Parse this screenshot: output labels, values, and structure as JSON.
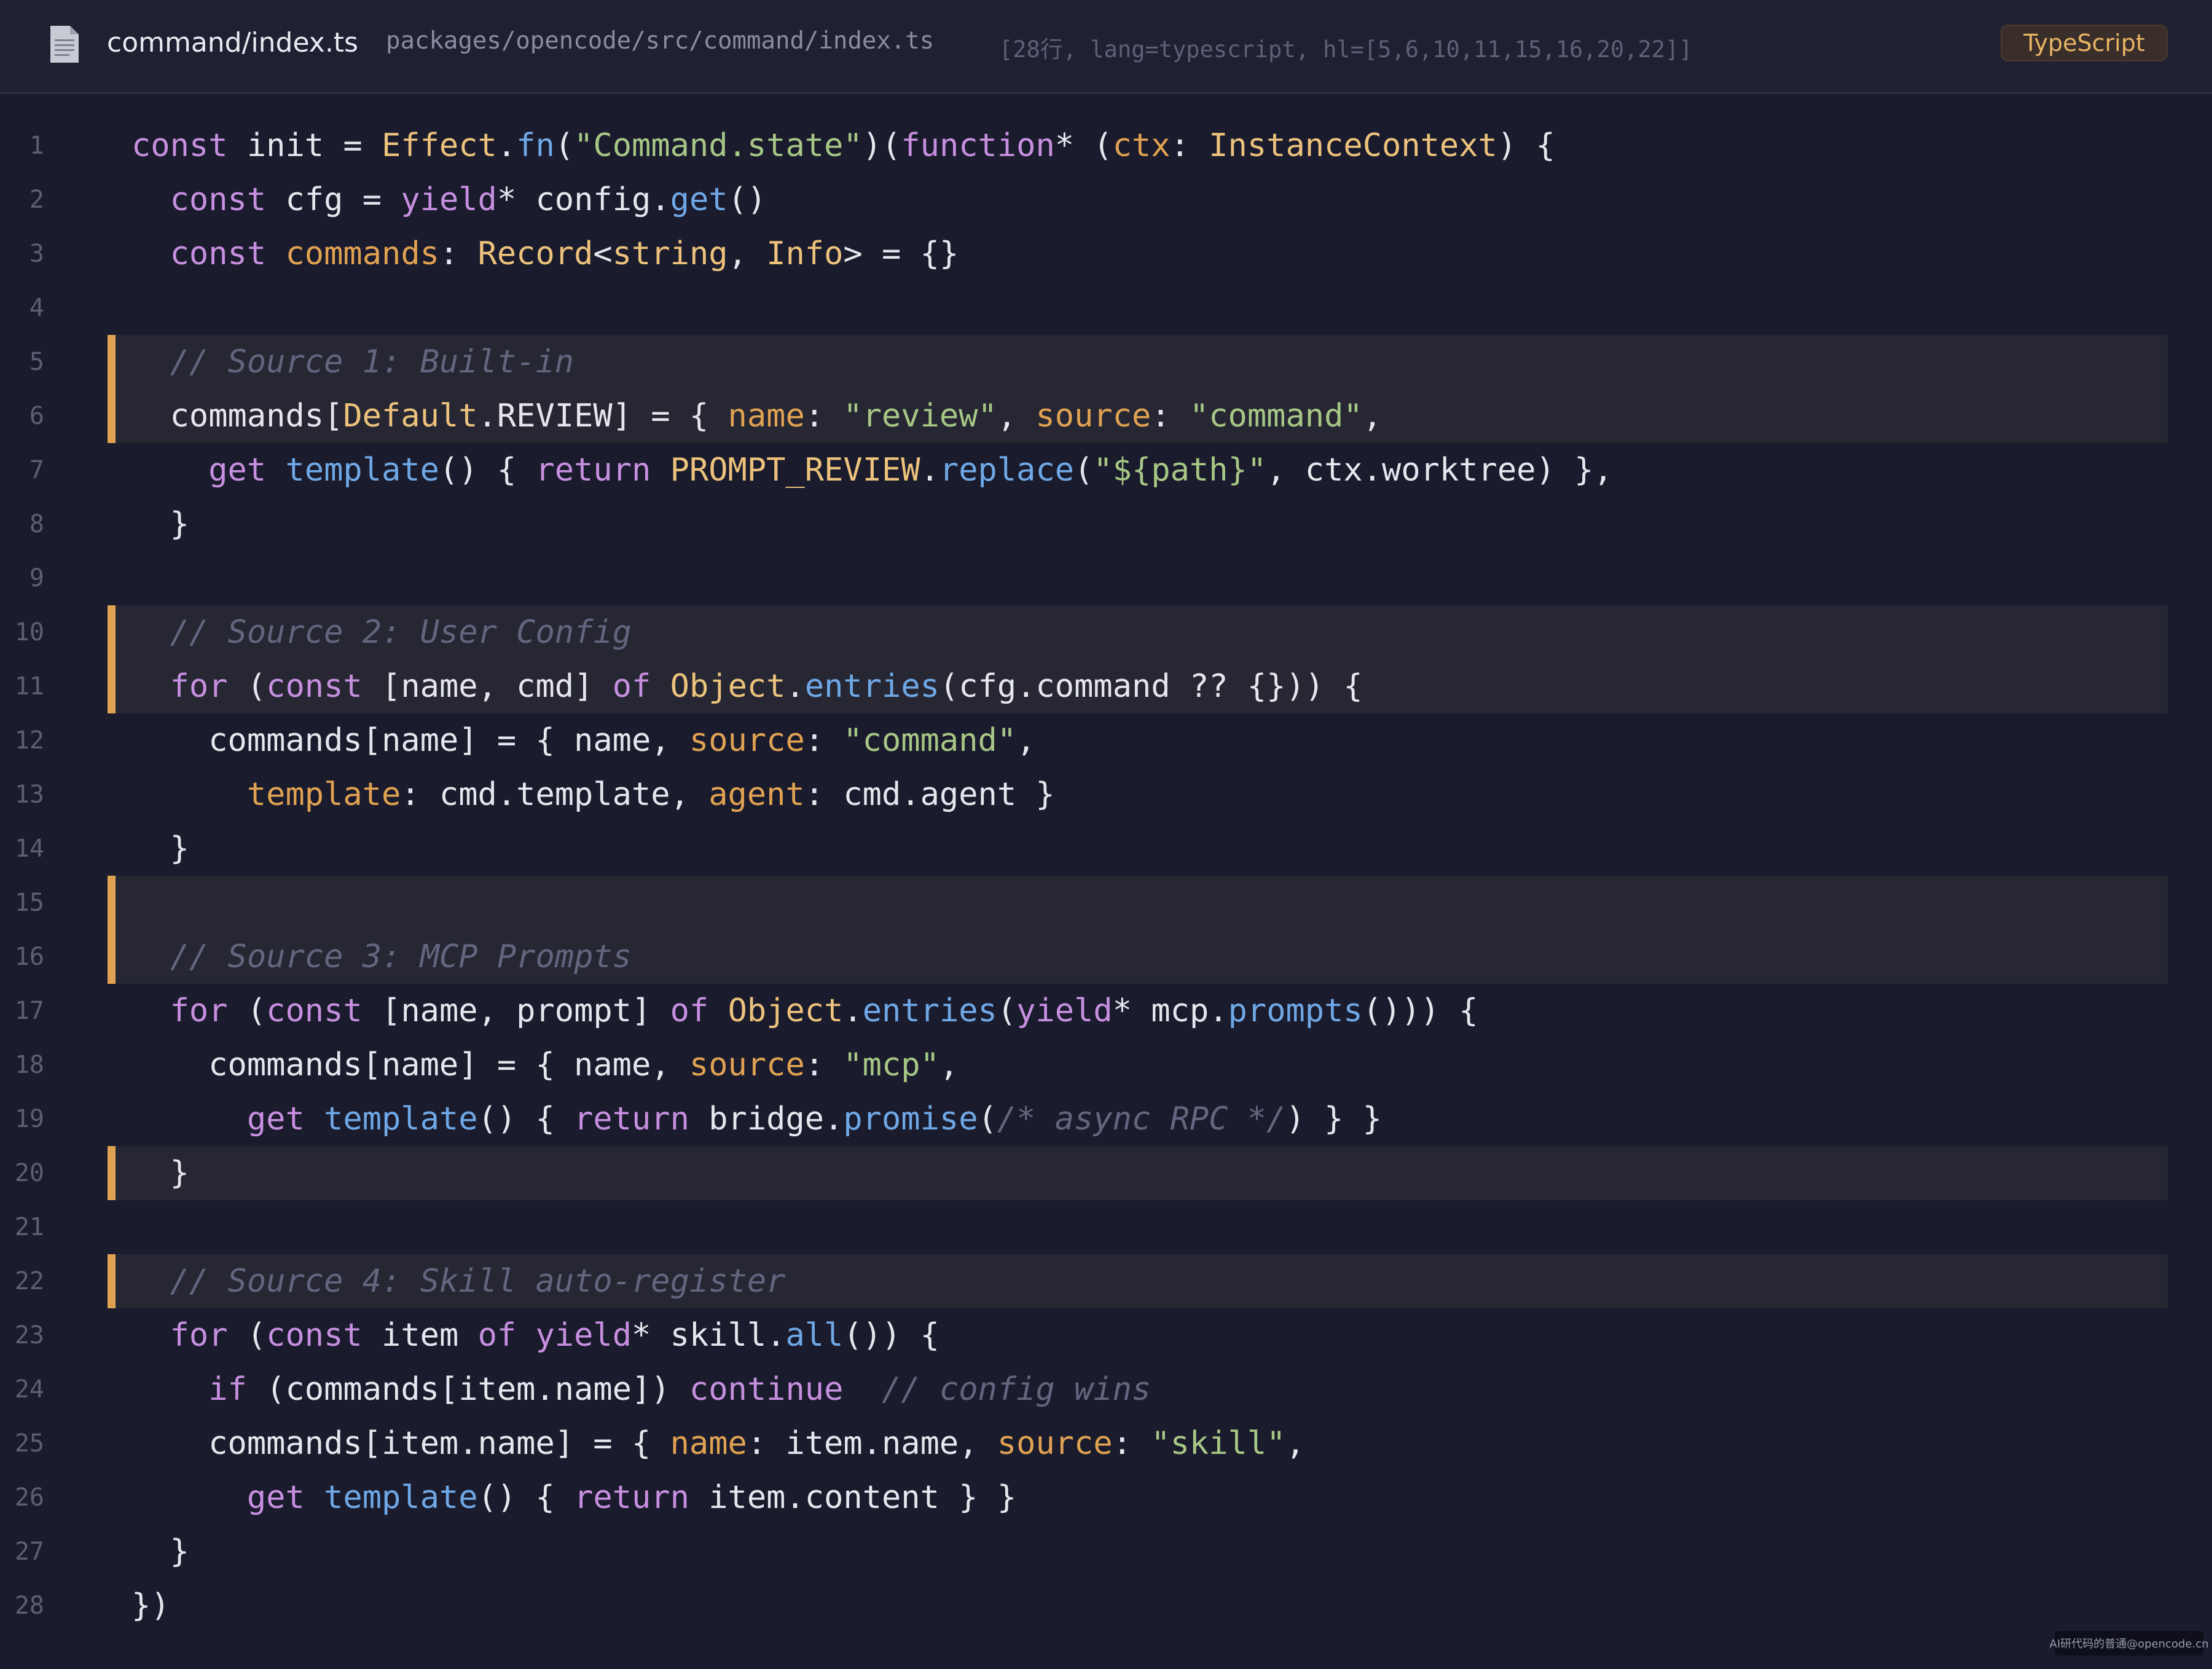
{
  "header": {
    "file_name": "command/index.ts",
    "file_path": "packages/opencode/src/command/index.ts",
    "file_meta": "[28行, lang=typescript, hl=[5,6,10,11,15,16,20,22]]",
    "language": "TypeScript",
    "icon": "document-icon"
  },
  "colors": {
    "background": "#1a1b2c",
    "highlight_bar": "#e0a252",
    "keyword": "#c78fe0",
    "function": "#6fa8e6",
    "type": "#ecc27c",
    "property": "#e0a252",
    "string": "#a6c785",
    "comment": "#62667e"
  },
  "code": {
    "highlighted_lines": [
      5,
      6,
      10,
      11,
      15,
      16,
      20,
      22
    ],
    "lines": [
      {
        "n": "1",
        "tokens": [
          [
            "kw",
            "const"
          ],
          [
            "pl",
            " init = "
          ],
          [
            "ty",
            "Effect"
          ],
          [
            "pl",
            "."
          ],
          [
            "fn",
            "fn"
          ],
          [
            "pl",
            "("
          ],
          [
            "st",
            "\"Command.state\""
          ],
          [
            "pl",
            ")("
          ],
          [
            "kw",
            "function"
          ],
          [
            "pl",
            "* ("
          ],
          [
            "pr",
            "ctx"
          ],
          [
            "pl",
            ": "
          ],
          [
            "ty",
            "InstanceContext"
          ],
          [
            "pl",
            ") {"
          ]
        ]
      },
      {
        "n": "2",
        "tokens": [
          [
            "pl",
            "  "
          ],
          [
            "kw",
            "const"
          ],
          [
            "pl",
            " cfg = "
          ],
          [
            "kw",
            "yield"
          ],
          [
            "pl",
            "* config."
          ],
          [
            "fn",
            "get"
          ],
          [
            "pl",
            "()"
          ]
        ]
      },
      {
        "n": "3",
        "tokens": [
          [
            "pl",
            "  "
          ],
          [
            "kw",
            "const"
          ],
          [
            "pl",
            " "
          ],
          [
            "pr",
            "commands"
          ],
          [
            "pl",
            ": "
          ],
          [
            "ty",
            "Record"
          ],
          [
            "pl",
            "<"
          ],
          [
            "ty",
            "string"
          ],
          [
            "pl",
            ", "
          ],
          [
            "ty",
            "Info"
          ],
          [
            "pl",
            "> = {}"
          ]
        ]
      },
      {
        "n": "4",
        "tokens": []
      },
      {
        "n": "5",
        "tokens": [
          [
            "pl",
            "  "
          ],
          [
            "cm",
            "// Source 1: Built-in"
          ]
        ]
      },
      {
        "n": "6",
        "tokens": [
          [
            "pl",
            "  commands["
          ],
          [
            "ty",
            "Default"
          ],
          [
            "pl",
            ".REVIEW] = { "
          ],
          [
            "pr",
            "name"
          ],
          [
            "pl",
            ": "
          ],
          [
            "st",
            "\"review\""
          ],
          [
            "pl",
            ", "
          ],
          [
            "pr",
            "source"
          ],
          [
            "pl",
            ": "
          ],
          [
            "st",
            "\"command\""
          ],
          [
            "pl",
            ","
          ]
        ]
      },
      {
        "n": "7",
        "tokens": [
          [
            "pl",
            "    "
          ],
          [
            "kw",
            "get"
          ],
          [
            "pl",
            " "
          ],
          [
            "fn",
            "template"
          ],
          [
            "pl",
            "() { "
          ],
          [
            "kw",
            "return"
          ],
          [
            "pl",
            " "
          ],
          [
            "ty",
            "PROMPT_REVIEW"
          ],
          [
            "pl",
            "."
          ],
          [
            "fn",
            "replace"
          ],
          [
            "pl",
            "("
          ],
          [
            "st",
            "\"${path}\""
          ],
          [
            "pl",
            ", ctx.worktree) },"
          ]
        ]
      },
      {
        "n": "8",
        "tokens": [
          [
            "pl",
            "  }"
          ]
        ]
      },
      {
        "n": "9",
        "tokens": []
      },
      {
        "n": "10",
        "tokens": [
          [
            "pl",
            "  "
          ],
          [
            "cm",
            "// Source 2: User Config"
          ]
        ]
      },
      {
        "n": "11",
        "tokens": [
          [
            "pl",
            "  "
          ],
          [
            "kw",
            "for"
          ],
          [
            "pl",
            " ("
          ],
          [
            "kw",
            "const"
          ],
          [
            "pl",
            " [name, cmd] "
          ],
          [
            "kw",
            "of"
          ],
          [
            "pl",
            " "
          ],
          [
            "ty",
            "Object"
          ],
          [
            "pl",
            "."
          ],
          [
            "fn",
            "entries"
          ],
          [
            "pl",
            "(cfg.command ?? {})) {"
          ]
        ]
      },
      {
        "n": "12",
        "tokens": [
          [
            "pl",
            "    commands[name] = { name, "
          ],
          [
            "pr",
            "source"
          ],
          [
            "pl",
            ": "
          ],
          [
            "st",
            "\"command\""
          ],
          [
            "pl",
            ","
          ]
        ]
      },
      {
        "n": "13",
        "tokens": [
          [
            "pl",
            "      "
          ],
          [
            "pr",
            "template"
          ],
          [
            "pl",
            ": cmd.template, "
          ],
          [
            "pr",
            "agent"
          ],
          [
            "pl",
            ": cmd.agent }"
          ]
        ]
      },
      {
        "n": "14",
        "tokens": [
          [
            "pl",
            "  }"
          ]
        ]
      },
      {
        "n": "15",
        "tokens": []
      },
      {
        "n": "16",
        "tokens": [
          [
            "pl",
            "  "
          ],
          [
            "cm",
            "// Source 3: MCP Prompts"
          ]
        ]
      },
      {
        "n": "17",
        "tokens": [
          [
            "pl",
            "  "
          ],
          [
            "kw",
            "for"
          ],
          [
            "pl",
            " ("
          ],
          [
            "kw",
            "const"
          ],
          [
            "pl",
            " [name, prompt] "
          ],
          [
            "kw",
            "of"
          ],
          [
            "pl",
            " "
          ],
          [
            "ty",
            "Object"
          ],
          [
            "pl",
            "."
          ],
          [
            "fn",
            "entries"
          ],
          [
            "pl",
            "("
          ],
          [
            "kw",
            "yield"
          ],
          [
            "pl",
            "* mcp."
          ],
          [
            "fn",
            "prompts"
          ],
          [
            "pl",
            "())) {"
          ]
        ]
      },
      {
        "n": "18",
        "tokens": [
          [
            "pl",
            "    commands[name] = { name, "
          ],
          [
            "pr",
            "source"
          ],
          [
            "pl",
            ": "
          ],
          [
            "st",
            "\"mcp\""
          ],
          [
            "pl",
            ","
          ]
        ]
      },
      {
        "n": "19",
        "tokens": [
          [
            "pl",
            "      "
          ],
          [
            "kw",
            "get"
          ],
          [
            "pl",
            " "
          ],
          [
            "fn",
            "template"
          ],
          [
            "pl",
            "() { "
          ],
          [
            "kw",
            "return"
          ],
          [
            "pl",
            " bridge."
          ],
          [
            "fn",
            "promise"
          ],
          [
            "pl",
            "("
          ],
          [
            "cm",
            "/* async RPC */"
          ],
          [
            "pl",
            ") } }"
          ]
        ]
      },
      {
        "n": "20",
        "tokens": [
          [
            "pl",
            "  }"
          ]
        ]
      },
      {
        "n": "21",
        "tokens": []
      },
      {
        "n": "22",
        "tokens": [
          [
            "pl",
            "  "
          ],
          [
            "cm",
            "// Source 4: Skill auto-register"
          ]
        ]
      },
      {
        "n": "23",
        "tokens": [
          [
            "pl",
            "  "
          ],
          [
            "kw",
            "for"
          ],
          [
            "pl",
            " ("
          ],
          [
            "kw",
            "const"
          ],
          [
            "pl",
            " item "
          ],
          [
            "kw",
            "of"
          ],
          [
            "pl",
            " "
          ],
          [
            "kw",
            "yield"
          ],
          [
            "pl",
            "* skill."
          ],
          [
            "fn",
            "all"
          ],
          [
            "pl",
            "()) {"
          ]
        ]
      },
      {
        "n": "24",
        "tokens": [
          [
            "pl",
            "    "
          ],
          [
            "kw",
            "if"
          ],
          [
            "pl",
            " (commands[item.name]) "
          ],
          [
            "kw",
            "continue"
          ],
          [
            "pl",
            "  "
          ],
          [
            "cm",
            "// config wins"
          ]
        ]
      },
      {
        "n": "25",
        "tokens": [
          [
            "pl",
            "    commands[item.name] = { "
          ],
          [
            "pr",
            "name"
          ],
          [
            "pl",
            ": item.name, "
          ],
          [
            "pr",
            "source"
          ],
          [
            "pl",
            ": "
          ],
          [
            "st",
            "\"skill\""
          ],
          [
            "pl",
            ","
          ]
        ]
      },
      {
        "n": "26",
        "tokens": [
          [
            "pl",
            "      "
          ],
          [
            "kw",
            "get"
          ],
          [
            "pl",
            " "
          ],
          [
            "fn",
            "template"
          ],
          [
            "pl",
            "() { "
          ],
          [
            "kw",
            "return"
          ],
          [
            "pl",
            " item.content } }"
          ]
        ]
      },
      {
        "n": "27",
        "tokens": [
          [
            "pl",
            "  }"
          ]
        ]
      },
      {
        "n": "28",
        "tokens": [
          [
            "pl",
            "})"
          ]
        ]
      }
    ]
  },
  "watermark": "AI研代码的普通@opencode.cn"
}
